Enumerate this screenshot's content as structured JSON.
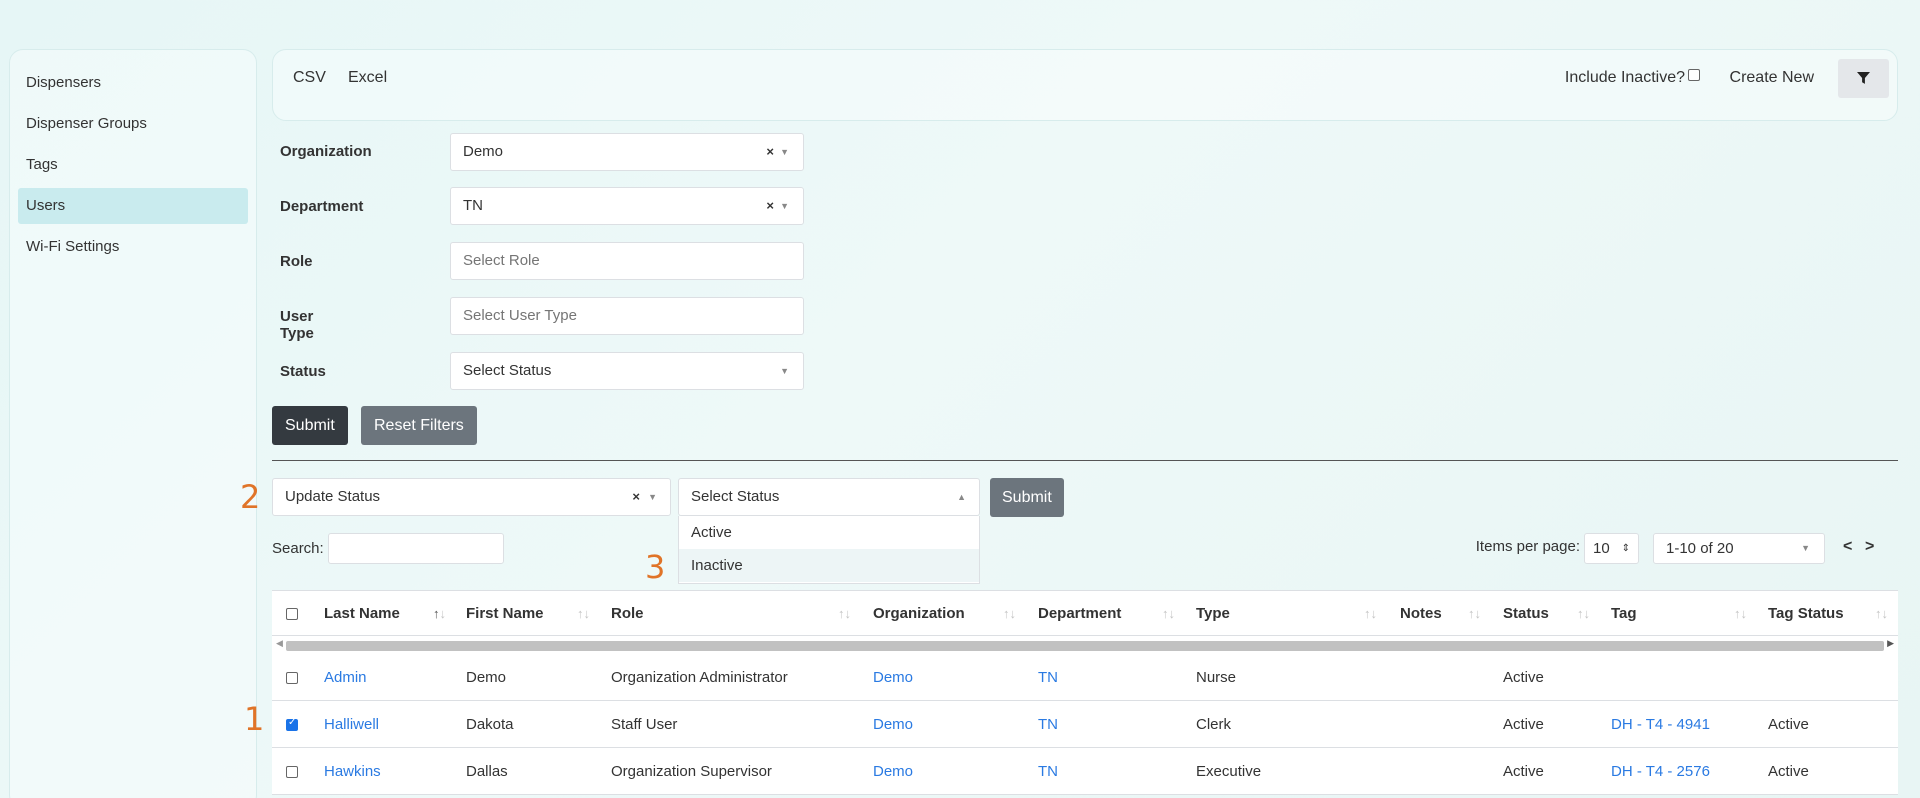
{
  "sidebar": {
    "items": [
      {
        "label": "Dispensers"
      },
      {
        "label": "Dispenser Groups"
      },
      {
        "label": "Tags"
      },
      {
        "label": "Users",
        "active": true
      },
      {
        "label": "Wi-Fi Settings"
      }
    ]
  },
  "toolbar": {
    "csv": "CSV",
    "excel": "Excel",
    "include_inactive": "Include Inactive?",
    "create_new": "Create New",
    "filter_icon": "filter-icon"
  },
  "filters": {
    "organization": {
      "label": "Organization",
      "value": "Demo"
    },
    "department": {
      "label": "Department",
      "value": "TN"
    },
    "role": {
      "label": "Role",
      "placeholder": "Select Role"
    },
    "user_type": {
      "label": "User Type",
      "placeholder": "Select User Type"
    },
    "status": {
      "label": "Status",
      "placeholder": "Select Status"
    },
    "submit": "Submit",
    "reset": "Reset Filters"
  },
  "bulk": {
    "action": "Update Status",
    "status_placeholder": "Select Status",
    "submit": "Submit",
    "options": [
      "Active",
      "Inactive"
    ]
  },
  "markers": {
    "one": "1",
    "two": "2",
    "three": "3"
  },
  "table_controls": {
    "search_label": "Search:",
    "items_per_page_label": "Items per page:",
    "items_per_page": "10",
    "range": "1-10 of 20",
    "prev": "<",
    "next": ">"
  },
  "table": {
    "columns": [
      "Last Name",
      "First Name",
      "Role",
      "Organization",
      "Department",
      "Type",
      "Notes",
      "Status",
      "Tag",
      "Tag Status"
    ],
    "rows": [
      {
        "checked": false,
        "last": "Admin",
        "first": "Demo",
        "role": "Organization Administrator",
        "org": "Demo",
        "dept": "TN",
        "type": "Nurse",
        "notes": "",
        "status": "Active",
        "tag": "",
        "tag_status": ""
      },
      {
        "checked": true,
        "last": "Halliwell",
        "first": "Dakota",
        "role": "Staff User",
        "org": "Demo",
        "dept": "TN",
        "type": "Clerk",
        "notes": "",
        "status": "Active",
        "tag": "DH - T4 - 4941",
        "tag_status": "Active"
      },
      {
        "checked": false,
        "last": "Hawkins",
        "first": "Dallas",
        "role": "Organization Supervisor",
        "org": "Demo",
        "dept": "TN",
        "type": "Executive",
        "notes": "",
        "status": "Active",
        "tag": "DH - T4 - 2576",
        "tag_status": "Active"
      }
    ]
  }
}
